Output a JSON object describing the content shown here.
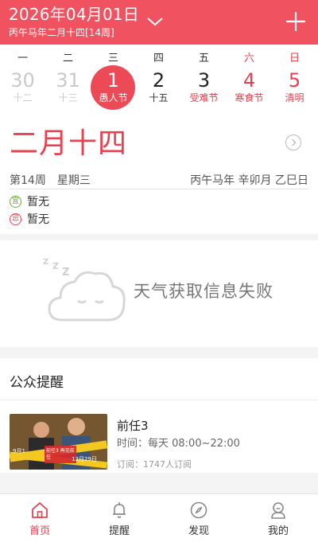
{
  "header": {
    "date_title": "2026年04月01日",
    "subtitle": "丙午马年二月十四[14周]",
    "chevron_icon": "chevron-down-icon",
    "add_icon": "plus-icon",
    "bg_color": "#f1525f"
  },
  "week": {
    "weekdays": [
      "一",
      "二",
      "三",
      "四",
      "五",
      "六",
      "日"
    ],
    "days": [
      {
        "num": "30",
        "lunar": "十二"
      },
      {
        "num": "31",
        "lunar": "十三"
      },
      {
        "num": "1",
        "lunar": "愚人节"
      },
      {
        "num": "2",
        "lunar": "十五"
      },
      {
        "num": "3",
        "lunar": "受难节"
      },
      {
        "num": "4",
        "lunar": "寒食节"
      },
      {
        "num": "5",
        "lunar": "清明"
      }
    ],
    "selected_color": "#ec4a57",
    "holiday_color": "#e8414f"
  },
  "detail": {
    "lunar_big": "二月十四",
    "week_info": "第14周　星期三",
    "ganzhi": "丙午马年 辛卯月 乙巳日",
    "yi_badge": "宜",
    "yi_text": "暂无",
    "ji_badge": "忌",
    "ji_text": "暂无"
  },
  "weather": {
    "message": "天气获取信息失败",
    "icon": "sleeping-cloud-icon"
  },
  "notices": {
    "title": "公众提醒",
    "item": {
      "name": "前任3",
      "time": "时间：每天 08:00~22:00",
      "subscribers": "订阅：1747人订阅",
      "poster_text_date": "12月29日",
      "poster_text_left": "9月1",
      "poster_title": "前任3 再见前任"
    }
  },
  "tabbar": {
    "tabs": [
      {
        "label": "首页",
        "icon": "home-icon"
      },
      {
        "label": "提醒",
        "icon": "bell-icon"
      },
      {
        "label": "发现",
        "icon": "compass-icon"
      },
      {
        "label": "我的",
        "icon": "user-icon"
      }
    ],
    "active_color": "#e8414f"
  }
}
